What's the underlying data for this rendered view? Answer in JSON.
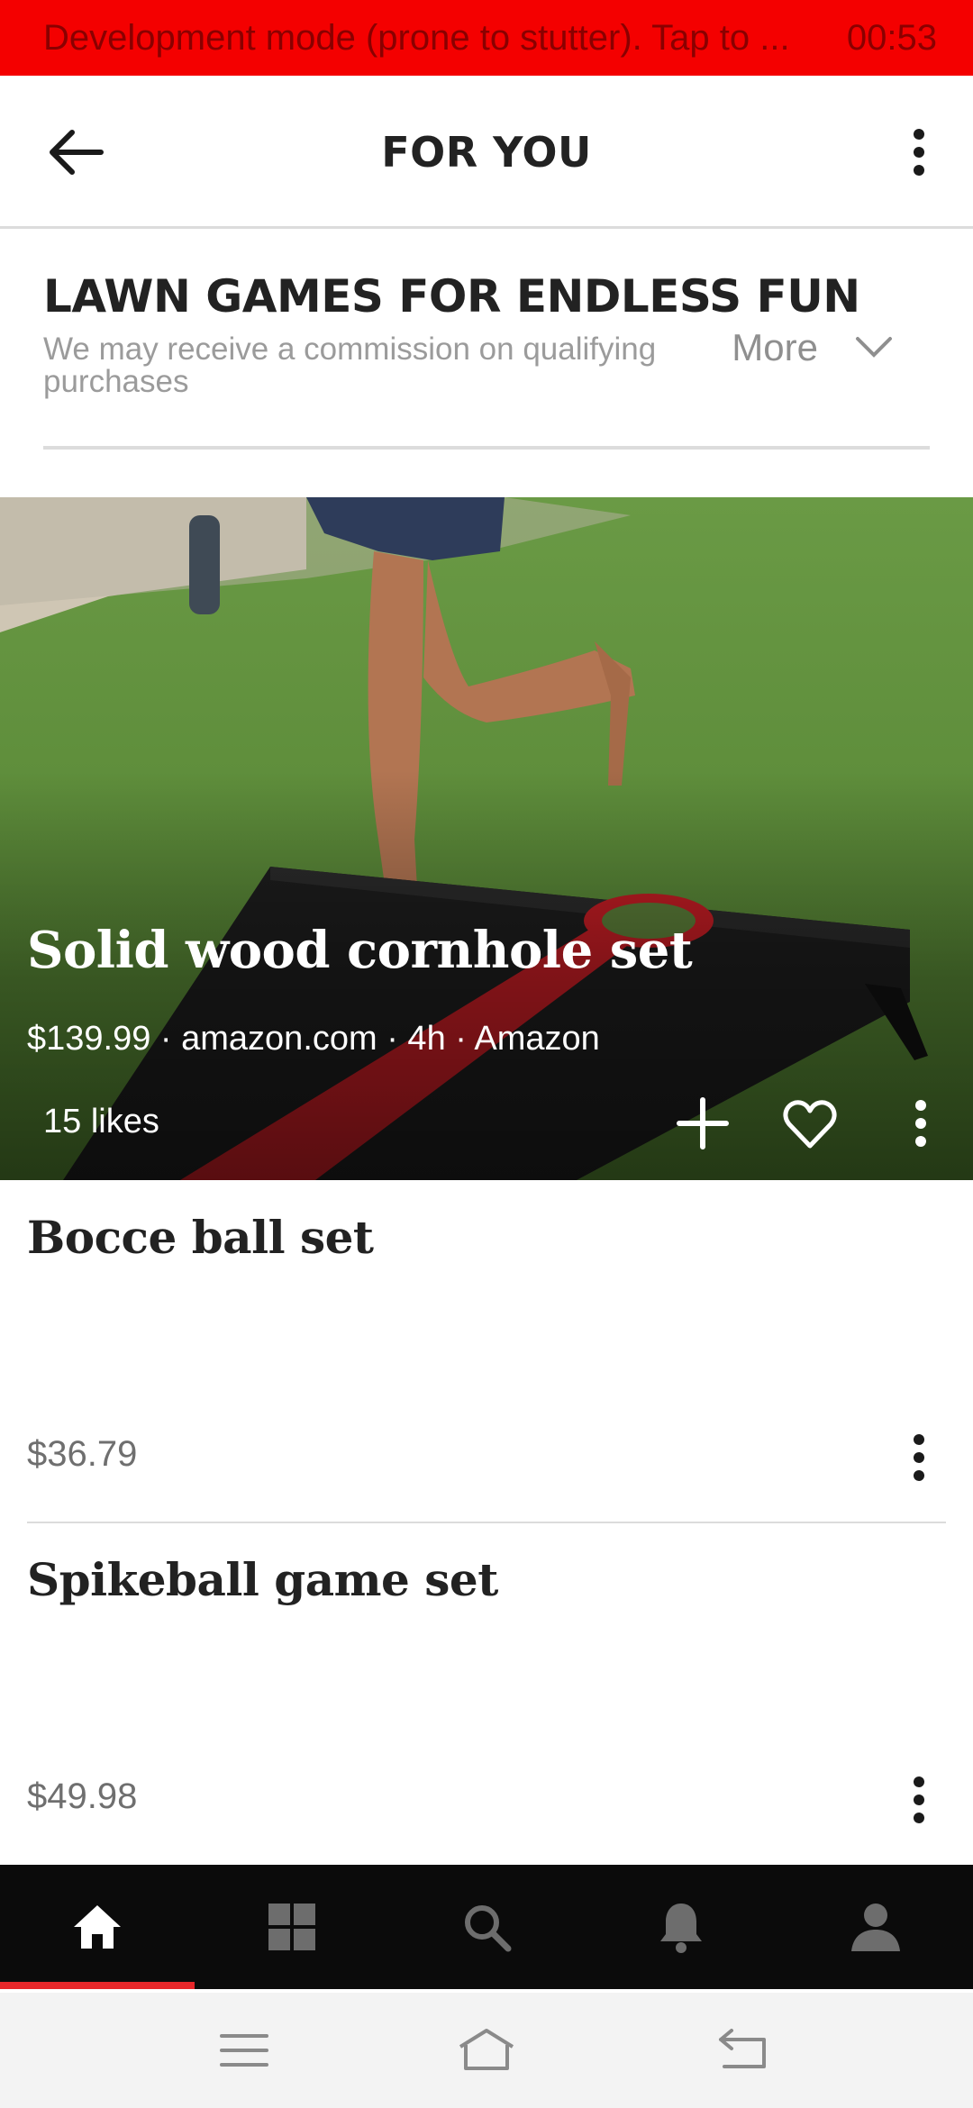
{
  "dev_banner": {
    "message": "Development mode (prone to stutter). Tap to ...",
    "time": "00:53"
  },
  "topbar": {
    "title": "FOR YOU",
    "back_icon": "arrow-left-icon",
    "menu_icon": "more-vertical-icon"
  },
  "section": {
    "heading": "LAWN GAMES FOR ENDLESS FUN",
    "subtext": "We may receive a commission on qualifying purchases",
    "more_label": "More"
  },
  "hero": {
    "title": "Solid wood cornhole set",
    "meta": "$139.99 · amazon.com · 4h · Amazon",
    "likes": "15 likes"
  },
  "items": [
    {
      "title": "Bocce ball set",
      "price": "$36.79"
    },
    {
      "title": "Spikeball game set",
      "price": "$49.98"
    }
  ],
  "bottom_nav": {
    "tabs": [
      "home-icon",
      "grid-icon",
      "search-icon",
      "bell-icon",
      "profile-icon"
    ],
    "active": "home-icon"
  },
  "system_nav": [
    "menu-icon",
    "home-outline-icon",
    "back-return-icon"
  ],
  "colors": {
    "banner": "#f40000",
    "accent": "#e8272a",
    "nav_bg": "#0b0b0b"
  }
}
